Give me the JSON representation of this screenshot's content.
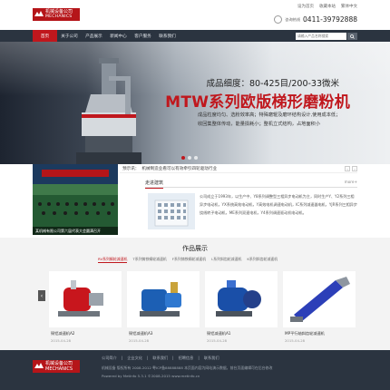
{
  "header": {
    "logo_cn": "机械设备公司",
    "logo_en": "MECHANICS",
    "top_links": [
      "设为首页",
      "收藏本站",
      "繁体中文"
    ],
    "hotline_label": "咨询热线",
    "hotline_number": "0411-39792888"
  },
  "nav": {
    "items": [
      "首页",
      "关于公司",
      "产品展示",
      "新闻中心",
      "客户服务",
      "联系我们"
    ],
    "active_index": 0,
    "search_placeholder": "请输入产品名称搜索"
  },
  "banner": {
    "line1": "成品细度：80-425目/200-33微米",
    "line2": "MTW系列欧版梯形磨粉机",
    "desc": "成品粒度均匀、选粉效率高；特殊磨辊及磨环结构设计,使用成本低；收回集整体传动，能量损耗小；整机立式结构，占地面积小",
    "dots": 3,
    "active_dot": 0
  },
  "news": {
    "label": "预示讯：",
    "headline": "机械制造业看可以有效牵引四轮驱动行业",
    "photo_caption": "某机械有限公司第六届代表大会圆满召开"
  },
  "about": {
    "title": "走进建筑",
    "more": "more+",
    "text": "公司成立于1993年，以生产中、Y8系列调整型三相异步电动机为主，同时生产Y、Y2系列三相异步电动机，YX系统高效电动机，Y高效电机调速电动机，IC系列减速器电机，YJR系列三相异步绕线转子电动机，ME系列双速电机，Y4系列调速驱动机电动机。"
  },
  "products": {
    "title": "作品展示",
    "tabs": [
      "RV系列蜗轮减速机",
      "T系列铸铁蜗轮减速机",
      "F系列铸铁蜗轮减速机",
      "L系列斜齿轮减速机",
      "K系列斜齿轮减速机"
    ],
    "items": [
      {
        "name": "铜铝减速机A2",
        "date": "2015-04-28"
      },
      {
        "name": "铜铝减速机A3",
        "date": "2015-04-28"
      },
      {
        "name": "铜铝减速机A1",
        "date": "2015-04-28"
      },
      {
        "name": "MP平行轴斜齿轮减速机",
        "date": "2015-04-28"
      }
    ]
  },
  "footer": {
    "links": [
      "公司简介",
      "企业文化",
      "联系我们",
      "招聘信息",
      "联系我们"
    ],
    "line1": "机械设备 版权所有 2008-2012 粤ICP备88888888 本页面内容为网站演示数据，前台页面编辑可在后台修改",
    "line2": "Powered by MetInfo 5.3.1 ©2008-2015  www.metinfo.cn"
  }
}
